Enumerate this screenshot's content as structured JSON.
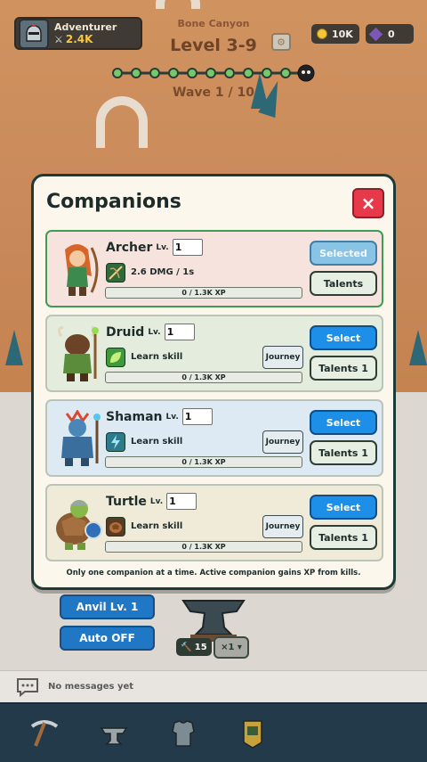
{
  "hud": {
    "player_name": "Adventurer",
    "player_power": "2.4K",
    "location": "Bone Canyon",
    "level": "Level 3-9",
    "coins": "10K",
    "gems": "0",
    "wave": "Wave 1 / 10",
    "wave_progress": {
      "nodes_total": 10,
      "current": 1
    }
  },
  "controls": {
    "anvil_level": "Anvil Lv. 1",
    "auto_toggle": "Auto OFF",
    "anvil_count": "15",
    "multiplier": "×1 ▾"
  },
  "chat": {
    "placeholder": "No messages yet"
  },
  "bottom_nav": [
    "pickaxe-icon",
    "anvil-icon",
    "armor-icon",
    "banner-icon"
  ],
  "modal": {
    "title": "Companions",
    "close_label": "×",
    "footnote": "Only one companion at a time. Active companion gains XP from kills.",
    "companions": [
      {
        "name": "Archer",
        "lv_label": "Lv.",
        "level": "1",
        "skill": "2.6 DMG / 1s",
        "xp": "0 / 1.3K XP",
        "primary": "Selected",
        "secondary": "Talents",
        "card_bg": "#f6e3de",
        "selected": true
      },
      {
        "name": "Druid",
        "lv_label": "Lv.",
        "level": "1",
        "skill": "Learn skill",
        "journey": "Journey",
        "xp": "0 / 1.3K XP",
        "primary": "Select",
        "secondary": "Talents 1",
        "card_bg": "#e3ecdd",
        "selected": false
      },
      {
        "name": "Shaman",
        "lv_label": "Lv.",
        "level": "1",
        "skill": "Learn skill",
        "journey": "Journey",
        "xp": "0 / 1.3K XP",
        "primary": "Select",
        "secondary": "Talents 1",
        "card_bg": "#deeaf3",
        "selected": false
      },
      {
        "name": "Turtle",
        "lv_label": "Lv.",
        "level": "1",
        "skill": "Learn skill",
        "journey": "Journey",
        "xp": "0 / 1.3K XP",
        "primary": "Select",
        "secondary": "Talents 1",
        "card_bg": "#f0ead8",
        "selected": false
      }
    ]
  },
  "colors": {
    "accent_blue": "#1d8fe8",
    "close_red": "#e8394a",
    "selected_green": "#3f9a55"
  }
}
